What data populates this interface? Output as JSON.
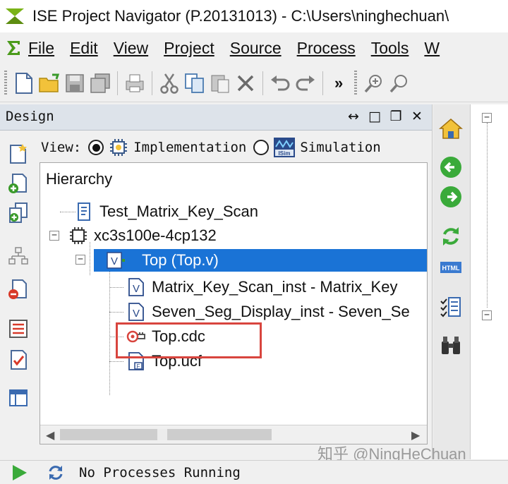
{
  "window": {
    "title": "ISE Project Navigator (P.20131013) - C:\\Users\\ninghechuan\\"
  },
  "menu": {
    "items": [
      {
        "label": "File",
        "key": "F"
      },
      {
        "label": "Edit",
        "key": "E"
      },
      {
        "label": "View",
        "key": "V"
      },
      {
        "label": "Project",
        "key": "j"
      },
      {
        "label": "Source",
        "key": "S"
      },
      {
        "label": "Process",
        "key": "P"
      },
      {
        "label": "Tools",
        "key": "T"
      },
      {
        "label": "W",
        "key": "W"
      }
    ]
  },
  "toolbar": {
    "buttons": [
      "new-file-icon",
      "open-folder-icon",
      "save-icon",
      "save-all-icon",
      "print-icon",
      "cut-icon",
      "copy-icon",
      "paste-icon",
      "delete-icon",
      "undo-icon",
      "redo-icon",
      "zoom-in-icon",
      "zoom-out-icon"
    ],
    "more_label": "»"
  },
  "design_panel": {
    "title": "Design",
    "controls": {
      "move": "↔",
      "maximize": "□",
      "restore": "❐",
      "close": "✕"
    },
    "view_label": "View:",
    "view_options": [
      {
        "label": "Implementation",
        "selected": true
      },
      {
        "label": "Simulation",
        "selected": false
      }
    ],
    "hierarchy_label": "Hierarchy",
    "tree": [
      {
        "label": "Test_Matrix_Key_Scan",
        "icon": "project-icon"
      },
      {
        "label": "xc3s100e-4cp132",
        "icon": "chip-icon"
      },
      {
        "label": "Top (Top.v)",
        "icon": "verilog-module-icon",
        "selected": true
      },
      {
        "label": "Matrix_Key_Scan_inst - Matrix_Key",
        "icon": "verilog-file-icon"
      },
      {
        "label": "Seven_Seg_Display_inst - Seven_Se",
        "icon": "verilog-file-icon"
      },
      {
        "label": "Top.cdc",
        "icon": "chipscope-cdc-icon"
      },
      {
        "label": "Top.ucf",
        "icon": "ucf-file-icon"
      }
    ]
  },
  "status": {
    "text": "No Processes Running"
  },
  "watermark": {
    "text": "知乎 @NingHeChuan"
  },
  "colors": {
    "selection": "#1a73d6",
    "highlight_box": "#d8453e",
    "panel_header": "#dde3ea"
  }
}
